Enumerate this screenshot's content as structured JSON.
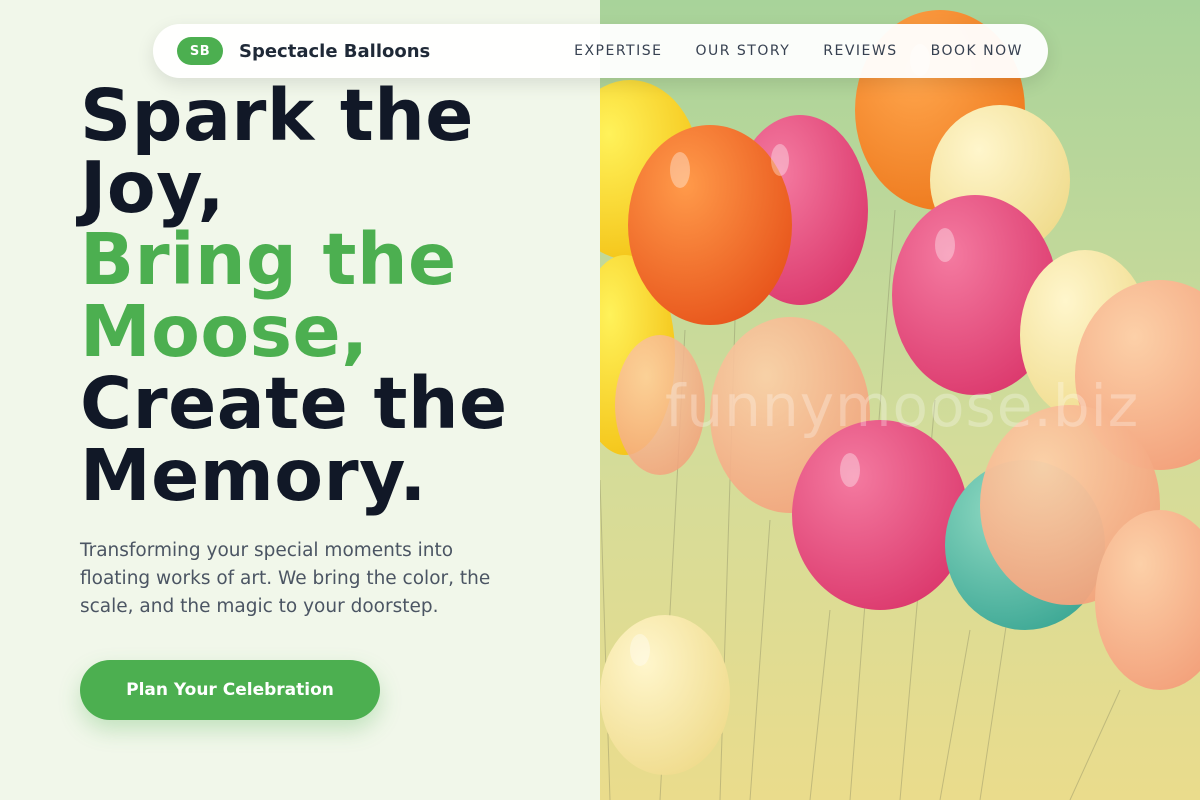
{
  "nav": {
    "logo_badge": "SB",
    "brand_name": "Spectacle Balloons",
    "links": [
      "EXPERTISE",
      "OUR STORY",
      "REVIEWS",
      "BOOK NOW"
    ]
  },
  "hero": {
    "headline_lines": [
      "Spark the",
      "Joy,",
      "Bring the",
      "Moose,",
      "Create the",
      "Memory."
    ],
    "subtitle": "Transforming your special moments into floating works of art. We bring the color, the scale, and the magic to your doorstep.",
    "cta_label": "Plan Your Celebration"
  },
  "image": {
    "watermark": "funnymoose.biz"
  },
  "colors": {
    "accent": "#4caf50",
    "headline": "#111827",
    "background": "#f1f7ea"
  }
}
